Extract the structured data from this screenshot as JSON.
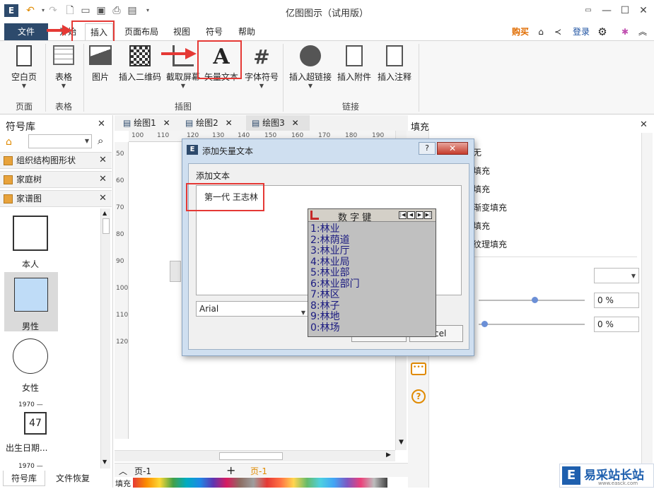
{
  "app": {
    "title": "亿图图示（试用版）"
  },
  "menu": {
    "file": "文件",
    "items": [
      {
        "label": "开始"
      },
      {
        "label": "插入"
      },
      {
        "label": "页面布局"
      },
      {
        "label": "视图"
      },
      {
        "label": "符号"
      },
      {
        "label": "帮助"
      }
    ],
    "buy": "购买",
    "login": "登录"
  },
  "ribbon": {
    "buttons": {
      "blank_page": "空白页",
      "table": "表格",
      "picture": "图片",
      "qrcode": "插入二维码",
      "screenshot": "截取屏幕",
      "vector_text": "矢量文本",
      "font_symbol": "字体符号",
      "hyperlink": "插入超链接",
      "attachment": "插入附件",
      "annotation": "插入注释"
    },
    "groups": {
      "page": "页面",
      "table": "表格",
      "illustration": "插图",
      "link": "链接"
    }
  },
  "left_panel": {
    "title": "符号库",
    "libraries": [
      {
        "label": "组织结构图形状"
      },
      {
        "label": "家庭树"
      },
      {
        "label": "家谱图"
      }
    ],
    "shapes": {
      "self": "本人",
      "male": "男性",
      "female": "女性",
      "year1": "1970 —",
      "age": "47",
      "birth": "出生日期...",
      "year2": "1970 —"
    },
    "bottom_tabs": {
      "library": "符号库",
      "recovery": "文件恢复"
    }
  },
  "doc_tabs": [
    {
      "label": "绘图1"
    },
    {
      "label": "绘图2"
    },
    {
      "label": "绘图3"
    }
  ],
  "ruler": {
    "h": [
      "100",
      "110",
      "120",
      "130",
      "140",
      "150",
      "160",
      "170",
      "180",
      "190"
    ],
    "v": [
      "50",
      "60",
      "70",
      "80",
      "90",
      "100",
      "110",
      "120"
    ]
  },
  "right_panel": {
    "title": "填充",
    "options": [
      "无",
      "填充",
      "填充",
      "渐变填充",
      "填充",
      "纹理填充"
    ],
    "pct1": "0 %",
    "pct2": "0 %"
  },
  "dialog": {
    "title": "添加矢量文本",
    "help": "?",
    "label": "添加文本",
    "text_value": "第一代 王志林",
    "font": "Arial",
    "cancel": "cel"
  },
  "ime": {
    "title": "数 字 键",
    "candidates": [
      "1:林业",
      "2:林荫道",
      "3:林业厅",
      "4:林业局",
      "5:林业部",
      "6:林业部门",
      "7:林区",
      "8:林子",
      "9:林地",
      "0:林场"
    ]
  },
  "bottom": {
    "page_tab": "页-1",
    "page_tab2": "页-1",
    "fill_label": "填充"
  },
  "watermark": {
    "text": "易采站长站",
    "sub": "www.easck.com"
  },
  "colors": {
    "accent_red": "#e53935",
    "file_button": "#2d4a6c",
    "buy": "#e06c00"
  }
}
